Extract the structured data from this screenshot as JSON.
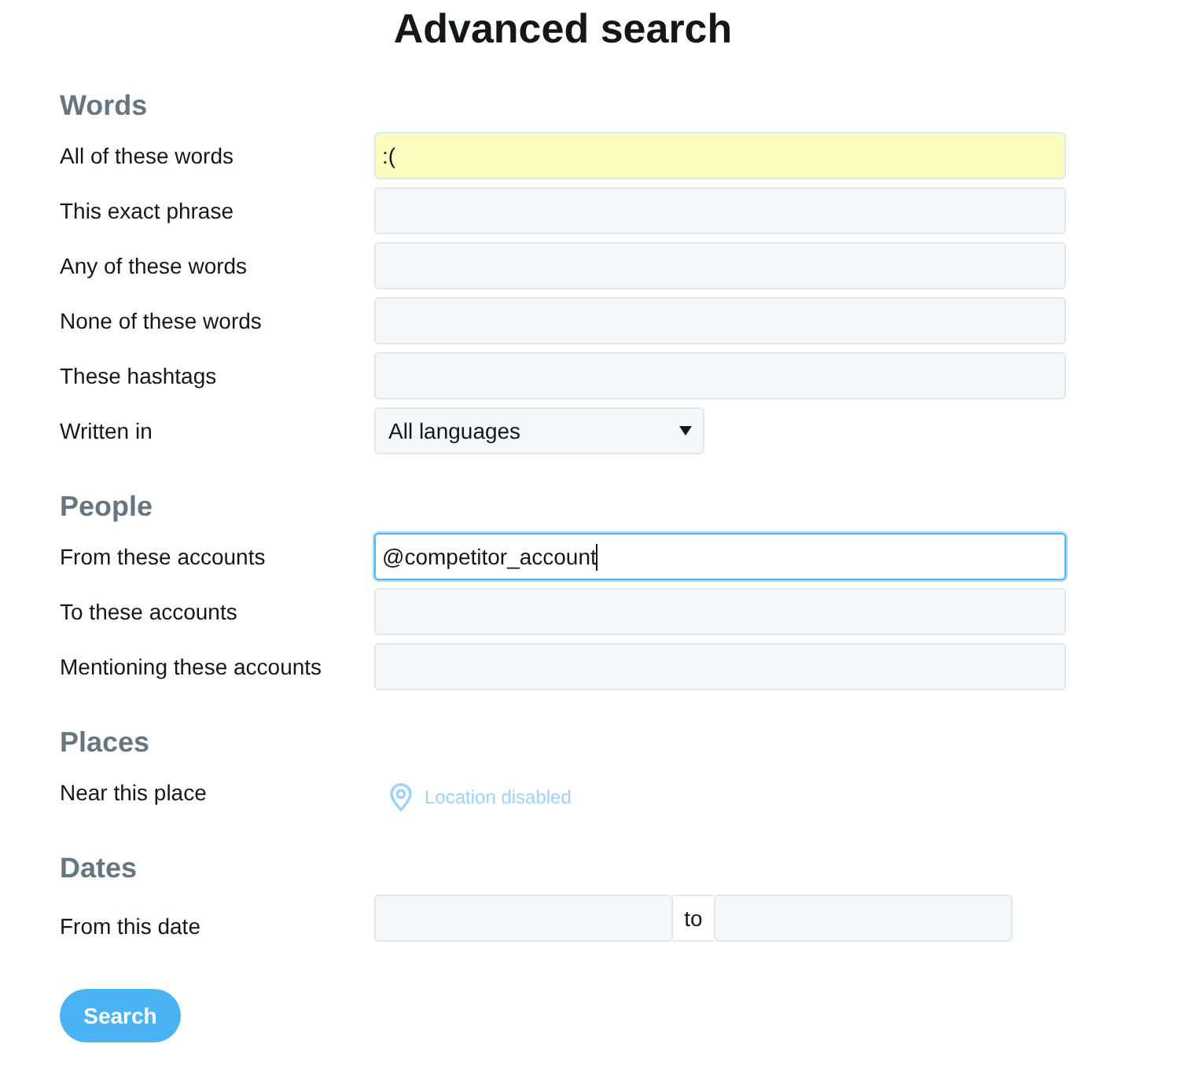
{
  "title": "Advanced search",
  "sections": [
    {
      "heading": "Words",
      "rows": [
        {
          "kind": "text",
          "label": "All of these words",
          "value": ":(",
          "autofilled": true,
          "focused": false
        },
        {
          "kind": "text",
          "label": "This exact phrase",
          "autofilled": false,
          "focused": false
        },
        {
          "kind": "text",
          "label": "Any of these words",
          "autofilled": false,
          "focused": false
        },
        {
          "kind": "text",
          "label": "None of these words",
          "autofilled": false,
          "focused": false
        },
        {
          "kind": "text",
          "label": "These hashtags",
          "autofilled": false,
          "focused": false
        },
        {
          "kind": "select",
          "label": "Written in",
          "value": "All languages"
        }
      ]
    },
    {
      "heading": "People",
      "rows": [
        {
          "kind": "text",
          "label": "From these accounts",
          "value": "@competitor_account",
          "autofilled": false,
          "focused": true
        },
        {
          "kind": "text",
          "label": "To these accounts",
          "autofilled": false,
          "focused": false
        },
        {
          "kind": "text",
          "label": "Mentioning these accounts",
          "autofilled": false,
          "focused": false
        }
      ]
    },
    {
      "heading": "Places",
      "rows": [
        {
          "kind": "location",
          "label": "Near this place",
          "status": "Location disabled",
          "disabled": true
        }
      ]
    },
    {
      "heading": "Dates",
      "rows": [
        {
          "kind": "date_range",
          "label": "From this date",
          "separator": "to"
        }
      ]
    }
  ],
  "search_button": "Search"
}
